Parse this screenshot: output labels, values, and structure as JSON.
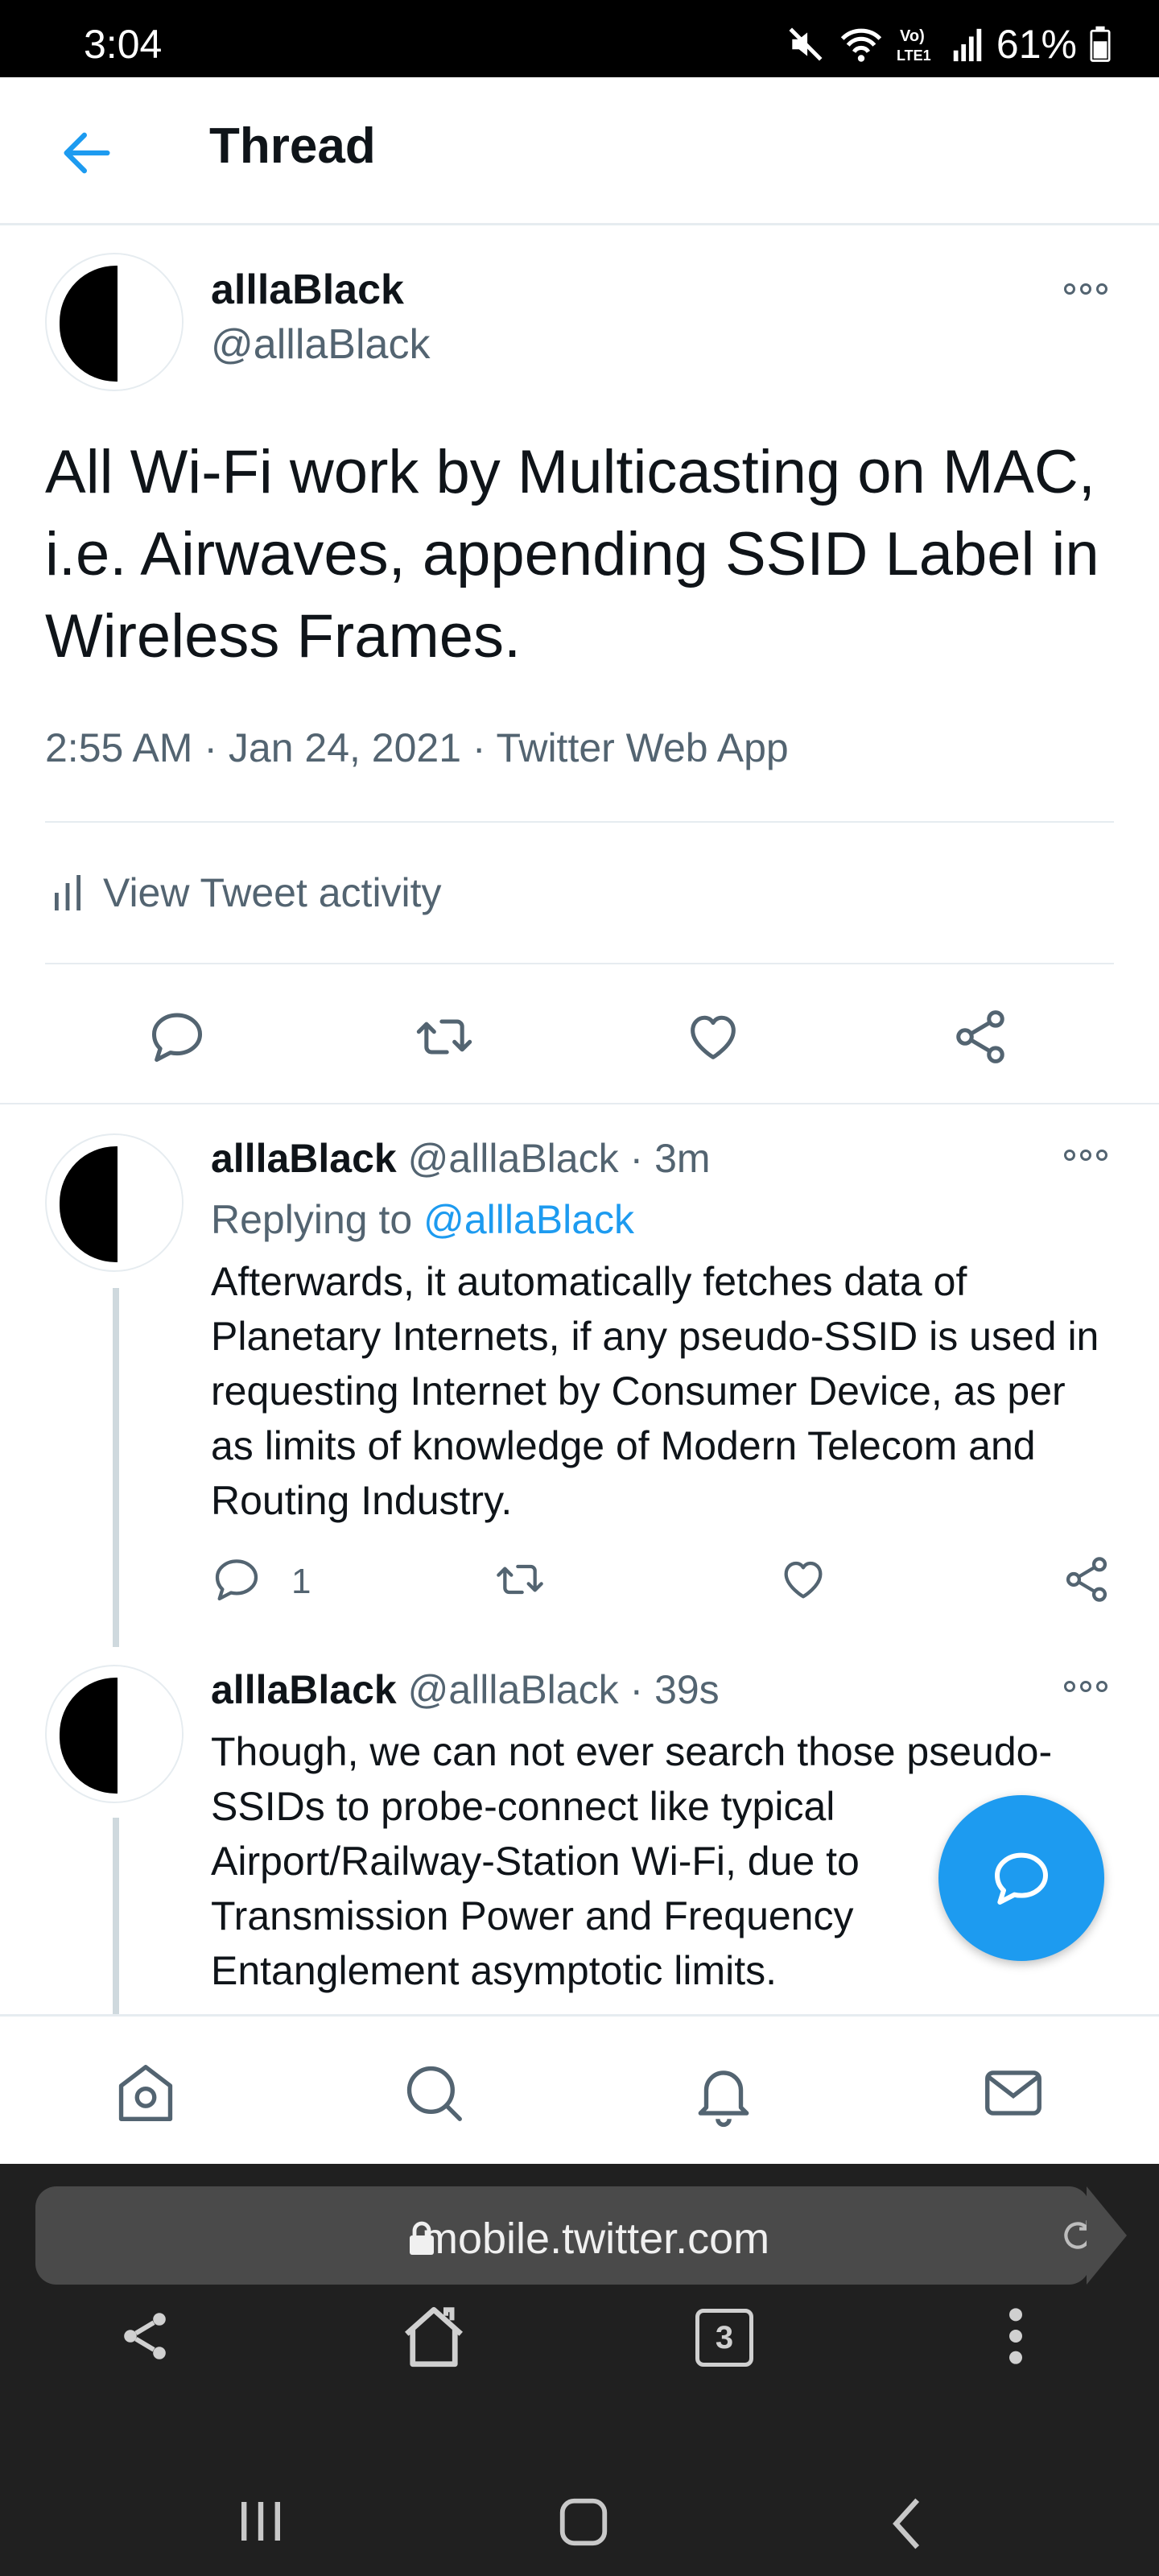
{
  "status_bar": {
    "time": "3:04",
    "battery": "61%",
    "icons": [
      "mute-icon",
      "wifi-icon",
      "volte-icon",
      "signal-icon",
      "battery-icon"
    ]
  },
  "header": {
    "title": "Thread",
    "back_icon": "arrow-left-icon"
  },
  "main_tweet": {
    "name": "alllaBlack",
    "handle": "@alllaBlack",
    "text": "All Wi-Fi work by Multicasting on MAC, i.e. Airwaves, appending SSID Label in Wireless Frames.",
    "meta": "2:55 AM · Jan 24, 2021 · Twitter Web App",
    "activity_label": "View Tweet activity",
    "actions": [
      "reply-icon",
      "retweet-icon",
      "like-icon",
      "share-icon"
    ]
  },
  "replies": [
    {
      "name": "alllaBlack",
      "handle": "@alllaBlack",
      "sep": "·",
      "time": "3m",
      "replying_prefix": "Replying to",
      "replying_to": "@alllaBlack",
      "text": "Afterwards, it automatically fetches data of Planetary Internets, if any pseudo-SSID is used in requesting Internet by Consumer Device, as per as limits of knowledge of Modern Telecom and Routing Industry.",
      "reply_count": "1"
    },
    {
      "name": "alllaBlack",
      "handle": "@alllaBlack",
      "sep": "·",
      "time": "39s",
      "text": "Though, we can not ever search those pseudo-SSIDs to probe-connect like typical Airport/Railway-Station Wi-Fi, due to Transmission Power and Frequency Entanglement asymptotic limits."
    }
  ],
  "bottom_nav": [
    "home-icon",
    "search-icon",
    "notifications-icon",
    "messages-icon"
  ],
  "browser": {
    "url": "mobile.twitter.com",
    "tab_count": "3"
  },
  "colors": {
    "accent": "#1d9bf0",
    "secondary_text": "#536471",
    "divider": "#e6ecf0"
  }
}
